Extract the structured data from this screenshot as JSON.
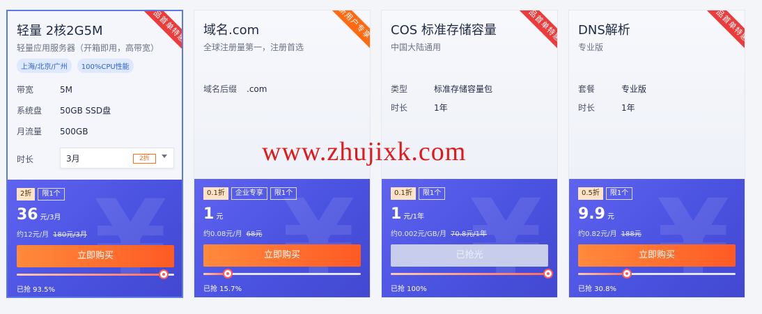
{
  "colors": {
    "accent_blue": "#4a52e0",
    "buy_orange": "#ff5a24",
    "ribbon_red": "#ec3b3b",
    "ribbon_orange": "#ff6a13",
    "watermark_red": "#e01a1a"
  },
  "watermark": "www.zhujixk.com",
  "cards": [
    {
      "title": "轻量 2核2G5M",
      "subtitle": "轻量应用服务器（开箱即用，高带宽）",
      "ribbon": "产品首单特惠",
      "tags": [
        "上海/北京/广州",
        "100%CPU性能"
      ],
      "specs": [
        {
          "k": "带宽",
          "v": "5M"
        },
        {
          "k": "系统盘",
          "v": "50GB SSD盘"
        },
        {
          "k": "月流量",
          "v": "500GB"
        }
      ],
      "duration_label": "时长",
      "duration_value": "3月",
      "duration_discount": "2折",
      "badges": [
        "2折",
        "限1个"
      ],
      "price": "36",
      "price_unit": "元/3月",
      "monthly": "约12元/月",
      "orig": "180元/3月",
      "buy_label": "立即购买",
      "sold_text": "已抢 93.5%",
      "progress": 0.935
    },
    {
      "title": "域名.com",
      "subtitle": "全球注册量第一，注册首选",
      "ribbon": "新用户专享",
      "specs": [
        {
          "k": "域名后缀",
          "v": ".com"
        }
      ],
      "badges": [
        "0.1折",
        "企业专享",
        "限1个"
      ],
      "price": "1",
      "price_unit": "元",
      "monthly": "约0.08元/月",
      "orig": "68元",
      "buy_label": "立即购买",
      "sold_text": "已抢 15.7%",
      "progress": 0.157
    },
    {
      "title": "COS 标准存储容量",
      "subtitle": "中国大陆通用",
      "ribbon": "产品首单特惠",
      "specs": [
        {
          "k": "类型",
          "v": "标准存储容量包"
        },
        {
          "k": "时长",
          "v": "1年"
        }
      ],
      "badges": [
        "0.1折",
        "限1个"
      ],
      "price": "1",
      "price_unit": "元/1年",
      "monthly": "约0.002元/GB/月",
      "orig": "70.8元/1年",
      "buy_label": "已抢光",
      "sold_text": "已抢 100%",
      "progress": 1.0
    },
    {
      "title": "DNS解析",
      "subtitle": "专业版",
      "ribbon": "产品首单特惠",
      "specs": [
        {
          "k": "套餐",
          "v": "专业版"
        },
        {
          "k": "时长",
          "v": "1年"
        }
      ],
      "badges": [
        "0.5折",
        "限1个"
      ],
      "price": "9.9",
      "price_unit": "元",
      "monthly": "约0.82元/月",
      "orig": "188元",
      "buy_label": "立即购买",
      "sold_text": "已抢 30.8%",
      "progress": 0.308
    }
  ]
}
